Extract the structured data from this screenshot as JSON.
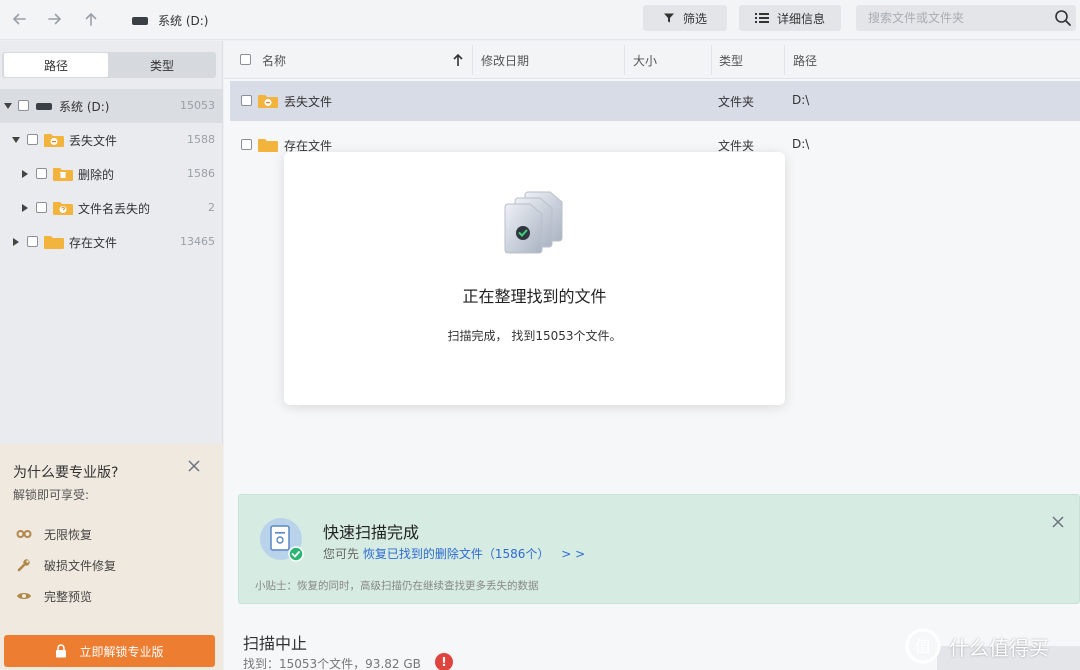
{
  "topbar": {
    "drive_label": "系统 (D:)",
    "filter_label": "筛选",
    "detail_label": "详细信息",
    "search_placeholder": "搜索文件或文件夹"
  },
  "sidebar": {
    "tab_path": "路径",
    "tab_type": "类型",
    "tree": [
      {
        "label": "系统 (D:)",
        "count": "15053"
      },
      {
        "label": "丢失文件",
        "count": "1588"
      },
      {
        "label": "删除的",
        "count": "1586"
      },
      {
        "label": "文件名丢失的",
        "count": "2"
      },
      {
        "label": "存在文件",
        "count": "13465"
      }
    ]
  },
  "pro_panel": {
    "title": "为什么要专业版?",
    "subtitle": "解锁即可享受:",
    "perks": [
      "无限恢复",
      "破损文件修复",
      "完整预览"
    ],
    "unlock_label": "立即解锁专业版"
  },
  "list": {
    "columns": [
      "名称",
      "修改日期",
      "大小",
      "类型",
      "路径"
    ],
    "rows": [
      {
        "name": "丢失文件",
        "modified": "",
        "size": "",
        "type": "文件夹",
        "path": "D:\\"
      },
      {
        "name": "存在文件",
        "modified": "",
        "size": "",
        "type": "文件夹",
        "path": "D:\\"
      }
    ]
  },
  "modal": {
    "title": "正在整理找到的文件",
    "message": "扫描完成， 找到15053个文件。"
  },
  "notice": {
    "title": "快速扫描完成",
    "prefix": "您可先",
    "link": "恢复已找到的删除文件（1586个）",
    "arrows": "> >",
    "tip": "小贴士：恢复的同时，高级扫描仍在继续查找更多丢失的数据"
  },
  "status": {
    "title": "扫描中止",
    "found": "找到：15053个文件，93.82 GB",
    "alert": "!"
  },
  "watermark": {
    "text": "什么值得买",
    "logo_glyph": "值"
  },
  "colors": {
    "accent_orange": "#ed7d31",
    "folder_yellow": "#f2b43c",
    "link_blue": "#2d6bd2",
    "success_green": "#2bb673",
    "alert_red": "#e0443e",
    "selection": "#d8dce6"
  }
}
